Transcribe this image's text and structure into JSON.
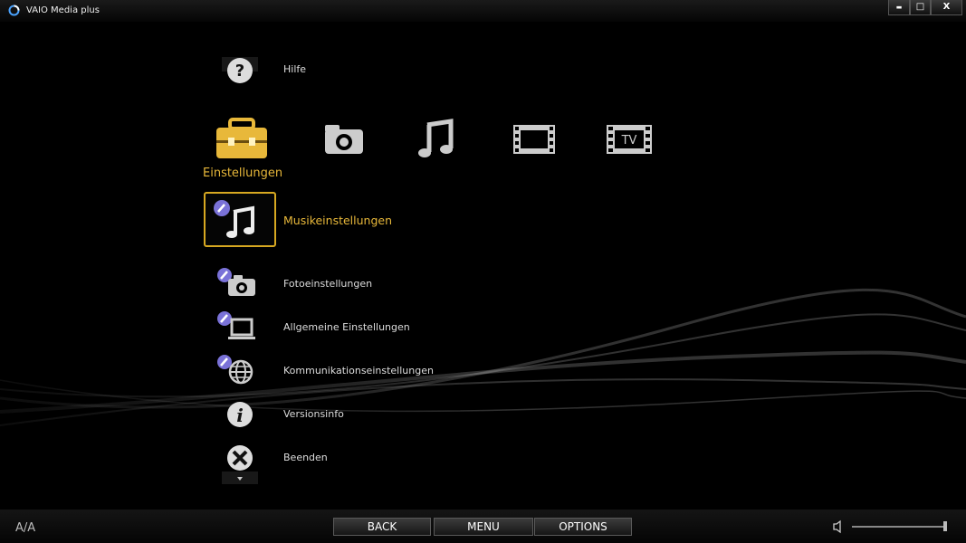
{
  "window": {
    "title": "VAIO Media plus",
    "minimize_glyph": "▬",
    "maximize_glyph": "□",
    "close_glyph": "X"
  },
  "help": {
    "label": "Hilfe",
    "icon": "question-icon"
  },
  "categories": {
    "selected_label": "Einstellungen",
    "items": [
      {
        "name": "settings-toolbox-icon",
        "color": "#e8b83a"
      },
      {
        "name": "camera-icon"
      },
      {
        "name": "music-note-icon"
      },
      {
        "name": "film-icon"
      },
      {
        "name": "tv-film-icon",
        "text": "TV"
      }
    ]
  },
  "selected_item": {
    "label": "Musikeinstellungen",
    "icon": "music-settings-icon"
  },
  "menu_items": [
    {
      "label": "Fotoeinstellungen",
      "icon": "photo-settings-icon"
    },
    {
      "label": "Allgemeine Einstellungen",
      "icon": "general-settings-icon"
    },
    {
      "label": "Kommunikationseinstellungen",
      "icon": "network-settings-icon"
    },
    {
      "label": "Versionsinfo",
      "icon": "info-icon"
    },
    {
      "label": "Beenden",
      "icon": "exit-icon"
    }
  ],
  "bottom": {
    "font_size_label": "A/A",
    "back_label": "BACK",
    "menu_label": "MENU",
    "options_label": "OPTIONS"
  },
  "colors": {
    "accent": "#e8b83a",
    "background": "#000000",
    "wrench_badge": "#7a72d8"
  }
}
